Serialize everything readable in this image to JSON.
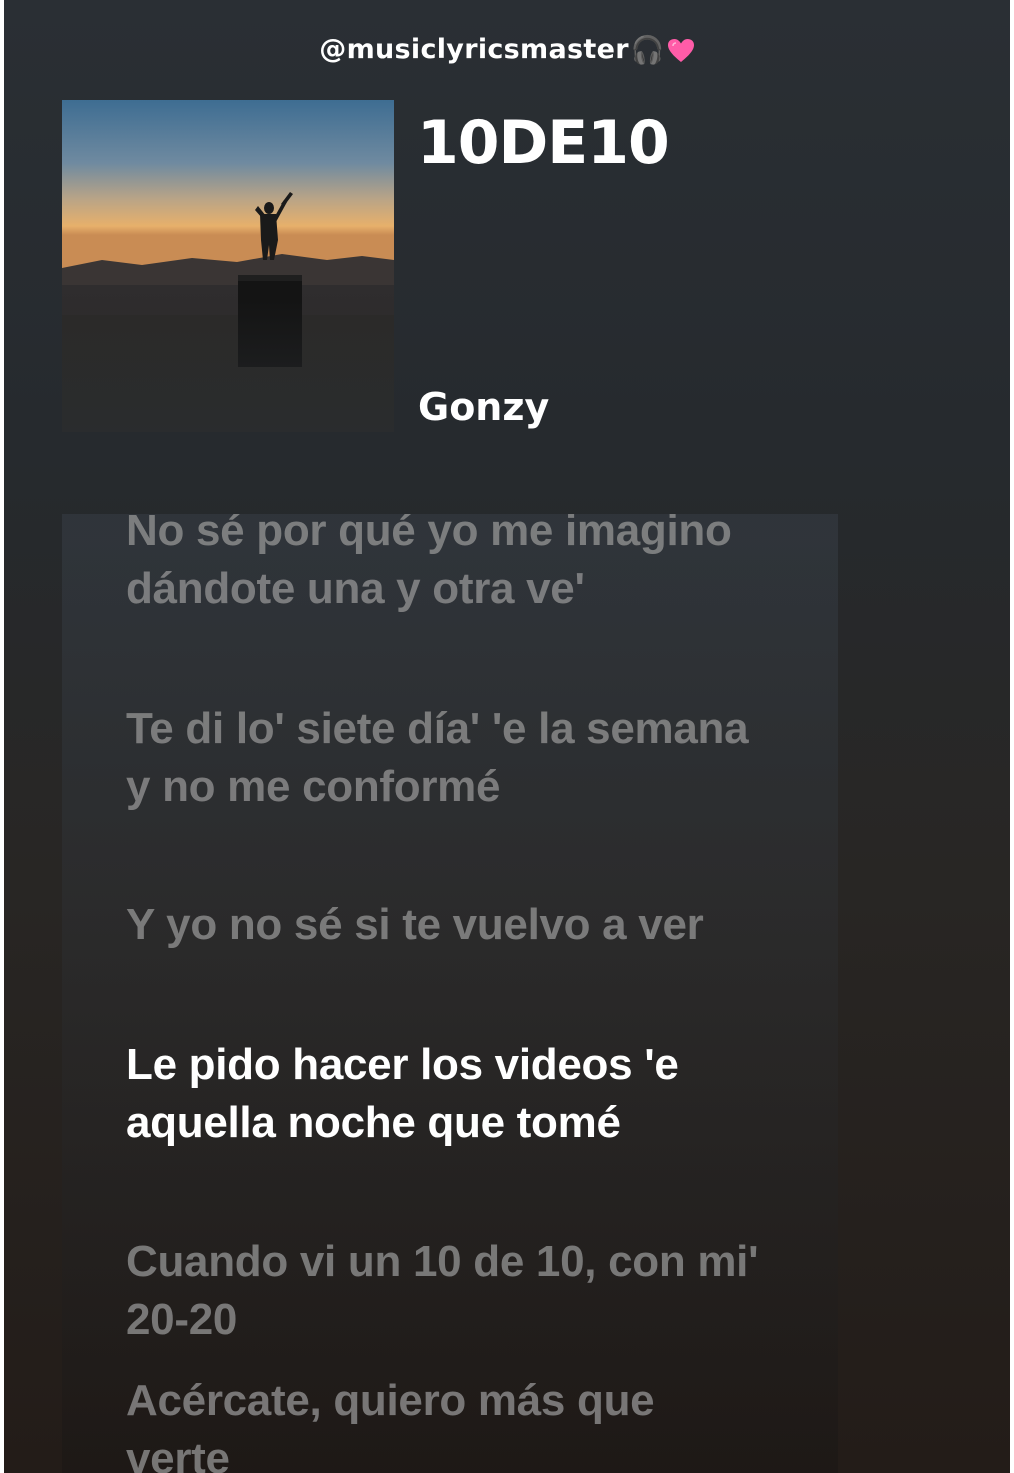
{
  "header": {
    "handle": "@musiclyricsmaster",
    "emoji": "🎧"
  },
  "song": {
    "title": "10DE10",
    "artist": "Gonzy",
    "album_art_icon": "album-art-silhouette-sunset"
  },
  "lyrics": [
    {
      "text": "No sé por qué yo me imagino dándote una y otra ve'",
      "active": false
    },
    {
      "text": "Te di lo' siete día' 'e la semana y no me conformé",
      "active": false
    },
    {
      "text": "Y yo no sé si te vuelvo a ver",
      "active": false
    },
    {
      "text": "Le pido hacer los videos 'e aquella noche que tomé",
      "active": true
    },
    {
      "text": "Cuando vi un 10 de 10, con mi' 20-20",
      "active": false
    },
    {
      "text": "Acércate, quiero más que verte",
      "active": false
    }
  ],
  "colors": {
    "active_lyric": "#ffffff",
    "inactive_lyric": "#969696",
    "heart": "#ff5ca8"
  }
}
